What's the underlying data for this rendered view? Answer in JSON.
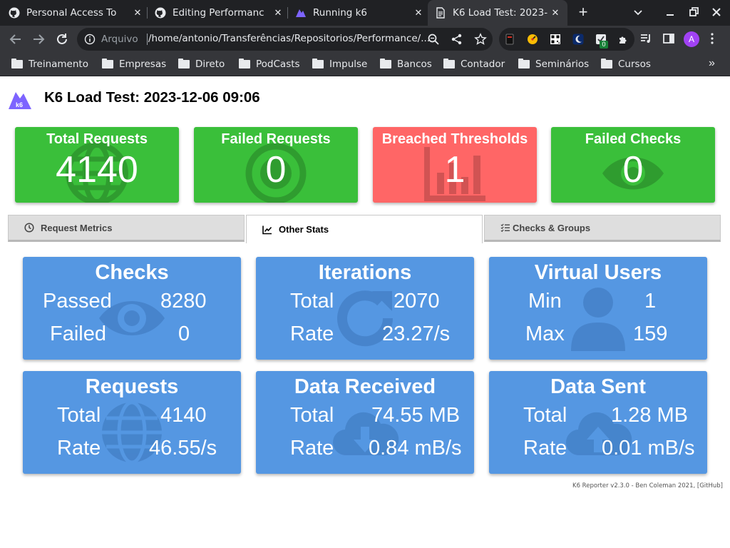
{
  "browser": {
    "tabs": [
      {
        "title": "Personal Access To",
        "icon": "github-icon"
      },
      {
        "title": "Editing Performanc",
        "icon": "github-icon"
      },
      {
        "title": "Running k6",
        "icon": "k6-icon"
      },
      {
        "title": "K6 Load Test: 2023-",
        "icon": "document-icon",
        "active": true
      }
    ],
    "address": {
      "label": "Arquivo",
      "url": "/home/antonio/Transferências/Repositorios/Performance/..."
    },
    "extension_badge": "0",
    "profile_initial": "A",
    "bookmarks": [
      "Treinamento",
      "Empresas",
      "Direto",
      "PodCasts",
      "Impulse",
      "Bancos",
      "Contador",
      "Seminários",
      "Cursos"
    ]
  },
  "page": {
    "title": "K6 Load Test: 2023-12-06 09:06",
    "summary": [
      {
        "label": "Total Requests",
        "value": "4140",
        "status": "ok",
        "icon": "globe-icon"
      },
      {
        "label": "Failed Requests",
        "value": "0",
        "status": "ok",
        "icon": "coin-icon"
      },
      {
        "label": "Breached Thresholds",
        "value": "1",
        "status": "fail",
        "icon": "bar-chart-icon"
      },
      {
        "label": "Failed Checks",
        "value": "0",
        "status": "ok",
        "icon": "eye-icon"
      }
    ],
    "tabs": [
      {
        "label": "Request Metrics",
        "icon": "clock-icon"
      },
      {
        "label": "Other Stats",
        "icon": "chart-line-icon",
        "selected": true
      },
      {
        "label": "Checks & Groups",
        "icon": "tasks-icon"
      }
    ],
    "cards": [
      {
        "title": "Checks",
        "icon": "eye-icon",
        "rows": [
          {
            "label": "Passed",
            "value": "8280"
          },
          {
            "label": "Failed",
            "value": "0"
          }
        ]
      },
      {
        "title": "Iterations",
        "icon": "refresh-icon",
        "rows": [
          {
            "label": "Total",
            "value": "2070"
          },
          {
            "label": "Rate",
            "value": "23.27/s"
          }
        ]
      },
      {
        "title": "Virtual Users",
        "icon": "user-icon",
        "rows": [
          {
            "label": "Min",
            "value": "1"
          },
          {
            "label": "Max",
            "value": "159"
          }
        ]
      },
      {
        "title": "Requests",
        "icon": "globe-icon",
        "rows": [
          {
            "label": "Total",
            "value": "4140"
          },
          {
            "label": "Rate",
            "value": "46.55/s"
          }
        ]
      },
      {
        "title": "Data Received",
        "icon": "cloud-download-icon",
        "rows": [
          {
            "label": "Total",
            "value": "74.55 MB"
          },
          {
            "label": "Rate",
            "value": "0.84 mB/s"
          }
        ]
      },
      {
        "title": "Data Sent",
        "icon": "cloud-upload-icon",
        "rows": [
          {
            "label": "Total",
            "value": "1.28 MB"
          },
          {
            "label": "Rate",
            "value": "0.01 mB/s"
          }
        ]
      }
    ],
    "footer": "K6 Reporter v2.3.0 - Ben Coleman 2021, [GitHub]"
  },
  "colors": {
    "ok": "#3abf3a",
    "fail": "#ff6666",
    "card": "#5597e2",
    "k6_brand": "#7d64ff"
  }
}
